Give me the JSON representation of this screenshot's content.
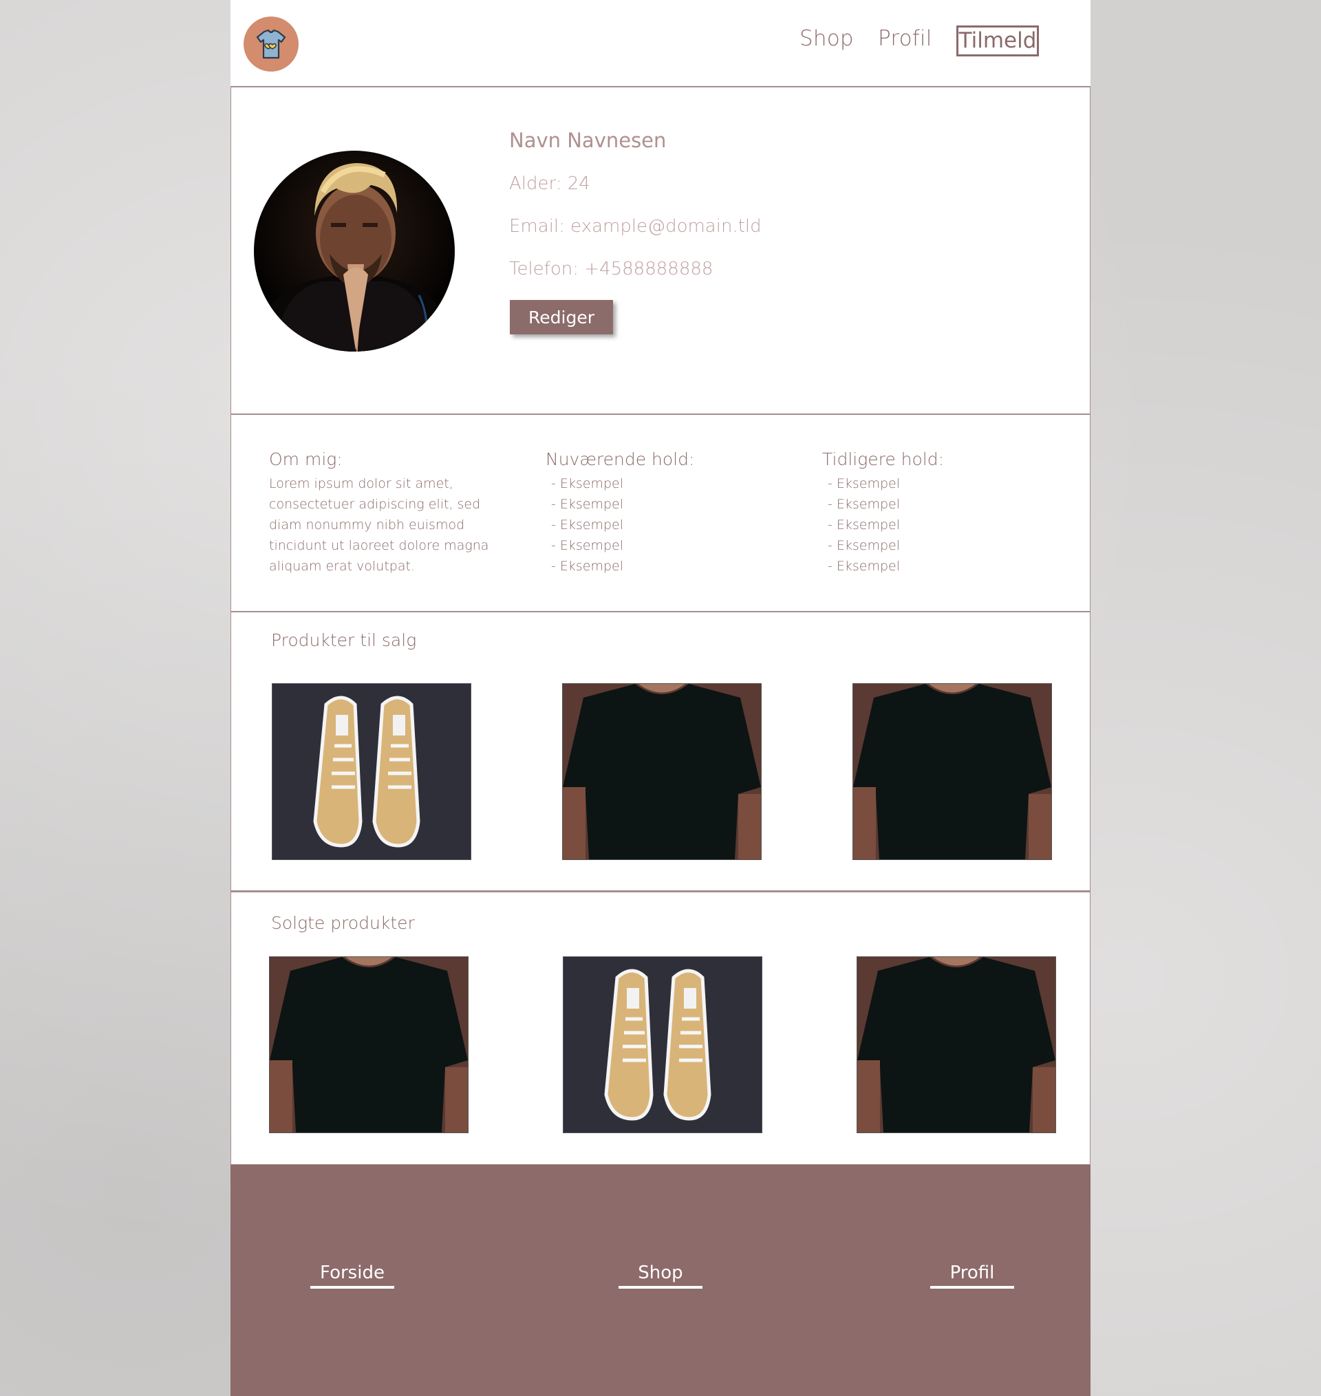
{
  "header": {
    "nav": {
      "shop": "Shop",
      "profil": "Profil",
      "signup": "Tilmeld"
    },
    "logo_icon": "tshirt-heart-icon"
  },
  "profile": {
    "name": "Navn Navnesen",
    "age": "Alder: 24",
    "email": "Email: example@domain.tld",
    "phone": "Telefon: +4588888888",
    "edit_label": "Rediger"
  },
  "info": {
    "about_title": "Om mig:",
    "about_text": "Lorem ipsum dolor sit amet, consectetuer adipiscing elit, sed diam nonummy nibh euismod tincidunt ut laoreet dolore magna aliquam erat volutpat.",
    "current_title": "Nuværende hold:",
    "current_items": [
      "- Eksempel",
      "- Eksempel",
      "- Eksempel",
      "- Eksempel",
      "- Eksempel"
    ],
    "previous_title": "Tidligere hold:",
    "previous_items": [
      "- Eksempel",
      "- Eksempel",
      "- Eksempel",
      "- Eksempel",
      "- Eksempel"
    ]
  },
  "for_sale": {
    "title": "Produkter til salg",
    "items": [
      "sneakers",
      "tshirt",
      "tshirt"
    ]
  },
  "sold": {
    "title": "Solgte produkter",
    "items": [
      "tshirt",
      "sneakers",
      "tshirt"
    ]
  },
  "footer": {
    "forside": "Forside",
    "shop": "Shop",
    "profil": "Profil"
  },
  "colors": {
    "accent": "#8c6b6b",
    "text": "#8c6a6a",
    "light_text": "#c0a0a0",
    "logo_bg": "#d38c6e"
  }
}
